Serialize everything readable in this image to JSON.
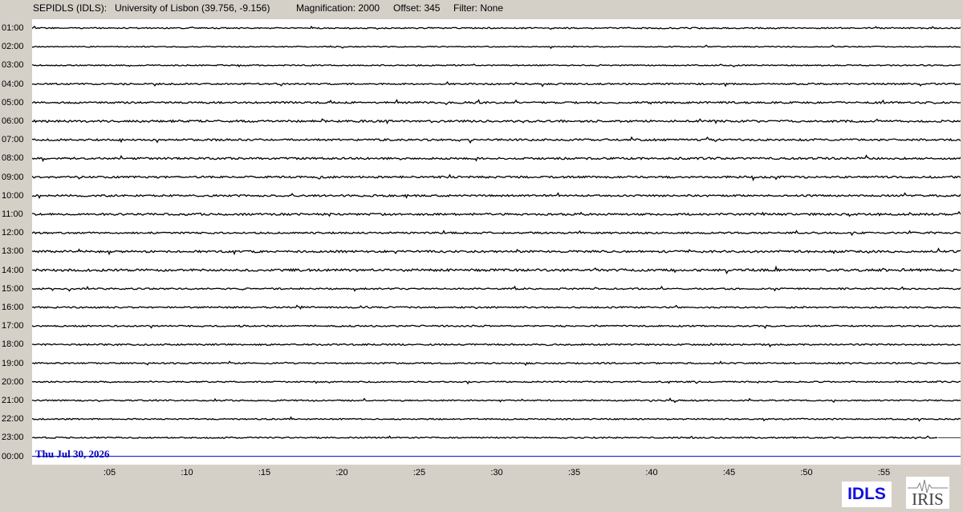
{
  "header": {
    "station": "SEPIDLS (IDLS):",
    "location": "University of Lisbon (39.756, -9.156)",
    "magnification": "Magnification: 2000",
    "offset": "Offset: 345",
    "filter": "Filter: None"
  },
  "date_label": "Thu Jul 30, 2026",
  "logos": {
    "network": "IDLS",
    "iris": "IRIS"
  },
  "colors": {
    "trace": "#000000",
    "trace_accent": "#000080",
    "current_hour": "#0000c0",
    "background": "#d4d0c8",
    "plot": "#ffffff"
  },
  "chart_data": {
    "type": "line",
    "hours": [
      "01:00",
      "02:00",
      "03:00",
      "04:00",
      "05:00",
      "06:00",
      "07:00",
      "08:00",
      "09:00",
      "10:00",
      "11:00",
      "12:00",
      "13:00",
      "14:00",
      "15:00",
      "16:00",
      "17:00",
      "18:00",
      "19:00",
      "20:00",
      "21:00",
      "22:00",
      "23:00",
      "00:00"
    ],
    "minute_ticks": [
      ":05",
      ":10",
      ":15",
      ":20",
      ":25",
      ":30",
      ":35",
      ":40",
      ":45",
      ":50",
      ":55"
    ],
    "minute_tick_values": [
      5,
      10,
      15,
      20,
      25,
      30,
      35,
      40,
      45,
      50,
      55
    ],
    "xlim": [
      0,
      60
    ],
    "hour_noise_levels": [
      0.5,
      0.4,
      0.45,
      0.6,
      0.7,
      0.8,
      0.75,
      0.75,
      0.75,
      0.7,
      0.75,
      0.65,
      0.8,
      0.9,
      0.6,
      0.6,
      0.55,
      0.6,
      0.55,
      0.5,
      0.5,
      0.5,
      0.5,
      0
    ],
    "recorded_until_minute": [
      60,
      60,
      60,
      60,
      60,
      60,
      60,
      60,
      60,
      60,
      60,
      60,
      60,
      60,
      60,
      60,
      60,
      60,
      60,
      60,
      60,
      60,
      58.5,
      0
    ]
  }
}
